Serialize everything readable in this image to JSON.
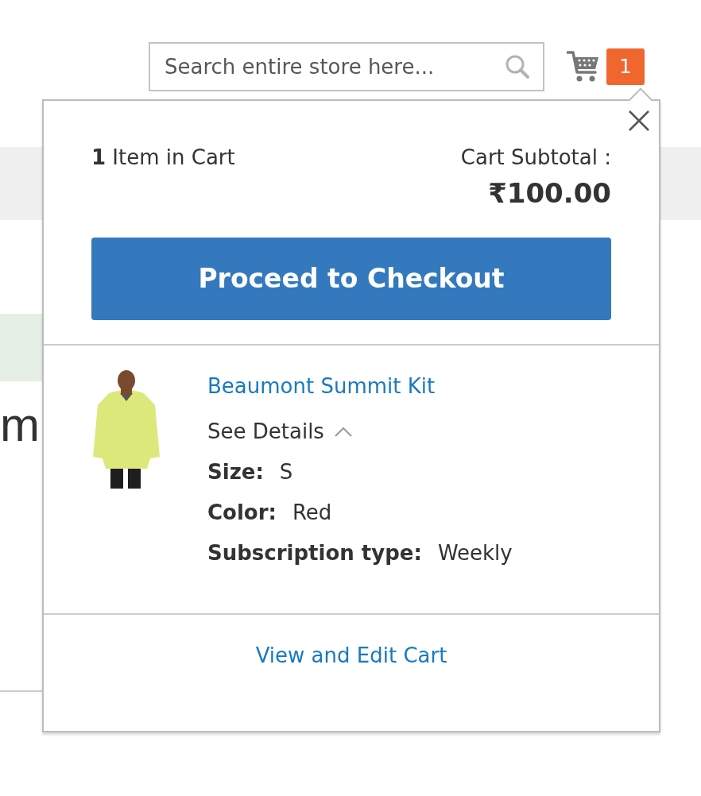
{
  "background": {
    "heading_fragment": "m"
  },
  "search": {
    "placeholder": "Search entire store here..."
  },
  "cart": {
    "count": "1"
  },
  "minicart": {
    "item_count": "1",
    "item_label": "Item in Cart",
    "subtotal_label": "Cart Subtotal :",
    "subtotal": "₹100.00",
    "checkout_button": "Proceed to Checkout",
    "items": [
      {
        "kind": "picture",
        "name": "Beaumont Summit Kit",
        "details_toggle": "See Details",
        "expanded": true,
        "options": [
          {
            "label": "Size:",
            "value": "S"
          },
          {
            "label": "Color:",
            "value": "Red"
          },
          {
            "label": "Subscription type:",
            "value": "Weekly"
          }
        ]
      }
    ],
    "view_cart_link": "View and Edit Cart"
  }
}
